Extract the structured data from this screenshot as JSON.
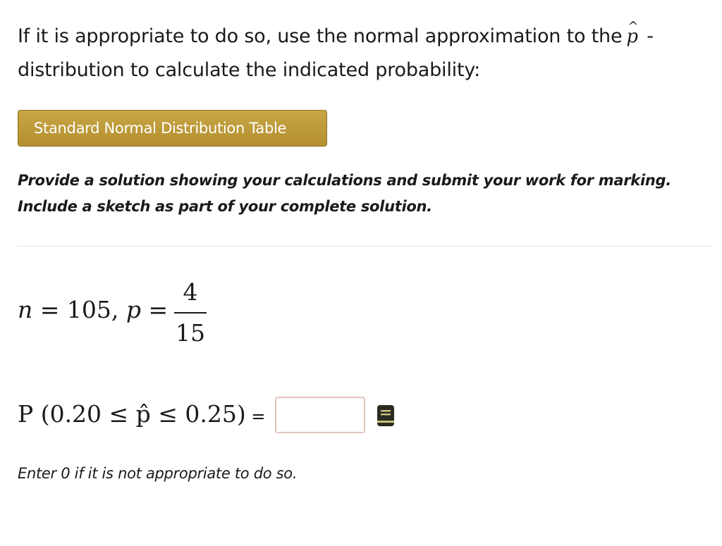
{
  "question": {
    "line1_before": "If it is appropriate to do so, use the normal approximation to the",
    "phat_symbol": "p",
    "phat_hat": "^",
    "line1_after": " -",
    "line2": "distribution to calculate the indicated probability:"
  },
  "table_button": {
    "label": "Standard Normal Distribution Table"
  },
  "instructions": {
    "line1": "Provide a solution showing your calculations and submit your work for marking.",
    "line2": "Include a sketch as part of your complete solution."
  },
  "given": {
    "n_var": "n",
    "equals": " = ",
    "n_value": "105, ",
    "p_var": "p",
    "p_equals": " =",
    "p_numerator": "4",
    "p_denominator": "15"
  },
  "probability": {
    "expression": "P (0.20 ≤  p̂  ≤ 0.25)",
    "equals": " =",
    "answer_value": "",
    "icon": "calculator-book-icon"
  },
  "note": {
    "text": "Enter 0 if it is not appropriate to do so."
  },
  "colors": {
    "button_gold": "#b99532",
    "input_border": "#e3c4bd",
    "icon_dark": "#2b2b22"
  }
}
